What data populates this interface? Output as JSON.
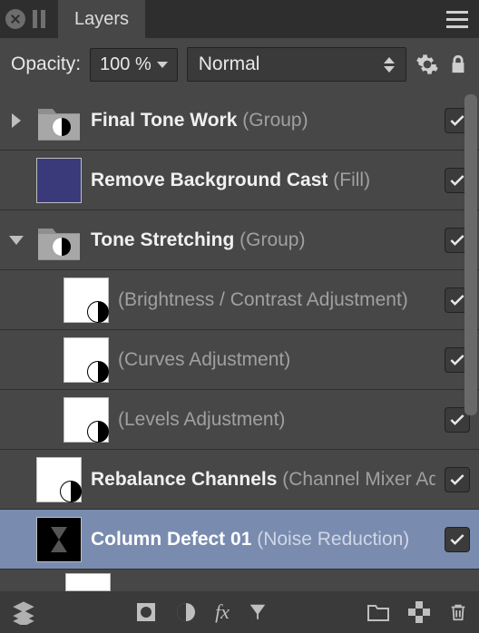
{
  "header": {
    "tab_label": "Layers"
  },
  "toolbar": {
    "opacity_label": "Opacity:",
    "opacity_value": "100 %",
    "blend_mode": "Normal"
  },
  "layers": [
    {
      "name": "Final Tone Work",
      "type": "(Group)",
      "arrow": "right",
      "thumb": "folder",
      "indent": 0,
      "visible": true
    },
    {
      "name": "Remove Background Cast",
      "type": "(Fill)",
      "arrow": "none",
      "thumb": "color",
      "indent": 0,
      "visible": true
    },
    {
      "name": "Tone Stretching",
      "type": "(Group)",
      "arrow": "down",
      "thumb": "folder",
      "indent": 0,
      "visible": true
    },
    {
      "name": "",
      "type": "(Brightness / Contrast Adjustment)",
      "arrow": "none",
      "thumb": "white-adj",
      "indent": 1,
      "visible": true
    },
    {
      "name": "",
      "type": "(Curves Adjustment)",
      "arrow": "none",
      "thumb": "white-adj",
      "indent": 1,
      "visible": true
    },
    {
      "name": "",
      "type": "(Levels Adjustment)",
      "arrow": "none",
      "thumb": "white-adj",
      "indent": 1,
      "visible": true
    },
    {
      "name": "Rebalance Channels",
      "type": "(Channel Mixer Adjustment)",
      "arrow": "none",
      "thumb": "white-adj",
      "indent": 0,
      "visible": true
    },
    {
      "name": "Column Defect 01",
      "type": "(Noise Reduction)",
      "arrow": "none",
      "thumb": "column-defect",
      "indent": 0,
      "visible": true,
      "selected": true
    }
  ],
  "icons": {
    "folder": "folder-with-adjustment",
    "gear": "gear-icon",
    "lock": "lock-icon"
  },
  "colors": {
    "fill_layer": "#3a3a7a",
    "selected_row": "#798baf",
    "panel_bg": "#474747"
  }
}
